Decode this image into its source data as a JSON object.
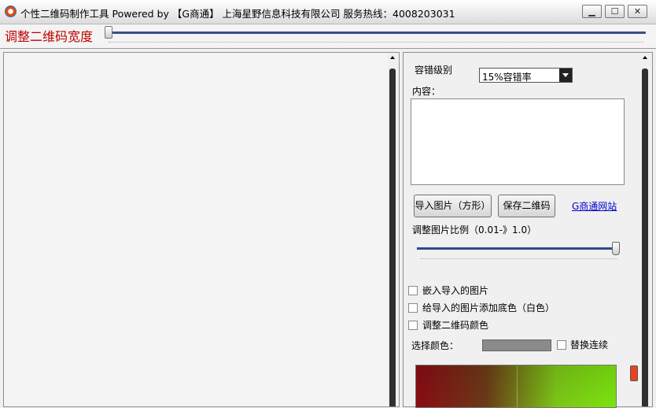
{
  "window": {
    "title": "个性二维码制作工具  Powered by 【G商通】 上海星野信息科技有限公司 服务热线：4008203031",
    "min_symbol": "▁",
    "max_symbol": "☐",
    "close_symbol": "✕"
  },
  "width_control": {
    "label": "调整二维码宽度",
    "value": 0
  },
  "panel": {
    "ecc_label": "容错级别",
    "ecc_value": "15%容错率",
    "content_label": "内容：",
    "content_value": "",
    "import_button": "导入图片（方形）",
    "save_button": "保存二维码",
    "site_link": "G商通网站",
    "ratio_label": "调整图片比例（0.01-》1.0）",
    "ratio_value": 1.0,
    "embed_checkbox": "嵌入导入的图片",
    "bg_checkbox": "给导入的图片添加底色（白色）",
    "color_checkbox": "调整二维码颜色",
    "select_color_label": "选择颜色：",
    "swap_checkbox": "替换连续"
  },
  "colors": {
    "width_label": "#c00000",
    "link": "#0000cc",
    "selected_color": "#8a8a8a",
    "hue_marker": "#e8431e"
  },
  "icons": [
    "app-logo-icon",
    "minimize-icon",
    "maximize-icon",
    "close-icon",
    "dropdown-arrow-icon",
    "scroll-up-icon",
    "mouse-cursor-icon"
  ]
}
